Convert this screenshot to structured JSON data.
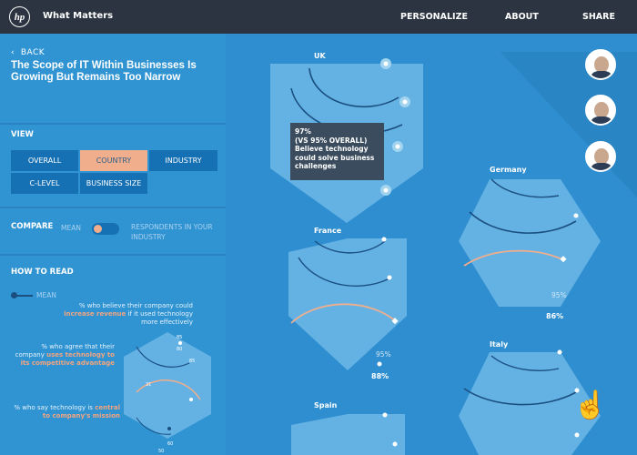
{
  "header": {
    "logo": "hp",
    "brand": "What Matters",
    "nav": [
      "PERSONALIZE",
      "ABOUT",
      "SHARE"
    ]
  },
  "left": {
    "back": "BACK",
    "title": "The Scope of IT Within Businesses Is Growing But Remains Too Narrow",
    "view_label": "VIEW",
    "view_options": [
      "OVERALL",
      "COUNTRY",
      "INDUSTRY",
      "C-LEVEL",
      "BUSINESS SIZE"
    ],
    "compare_label": "COMPARE",
    "compare_left": "MEAN",
    "compare_right": "RESPONDENTS IN YOUR INDUSTRY",
    "how_label": "HOW TO READ",
    "legend_mean": "MEAN",
    "how_items": [
      {
        "pre": "% who believe their company could",
        "hl": "increase revenue",
        "post": "if it used technology more effectively"
      },
      {
        "pre": "% who agree that their company",
        "hl": "uses technology to its competitive advantage",
        "post": ""
      },
      {
        "pre": "% who say technology is",
        "hl": "central to company's mission",
        "post": ""
      }
    ],
    "how_ticks": [
      "85",
      "80",
      "85",
      "31",
      "60",
      "50"
    ]
  },
  "countries": {
    "uk": "UK",
    "france": "France",
    "spain": "Spain",
    "germany": "Germany",
    "italy": "Italy",
    "france_pct": "88%",
    "france_sub": "95%",
    "germany_pct": "86%",
    "germany_sub": "95%"
  },
  "tooltip": {
    "line1": "97%",
    "line2": "(VS 95% OVERALL)",
    "line3": "Believe technology could solve business challenges"
  },
  "colors": {
    "bg": "#2f8ed0",
    "hex": "#64b2e4",
    "accent": "#f0ae8c",
    "dark": "#2b3440"
  }
}
